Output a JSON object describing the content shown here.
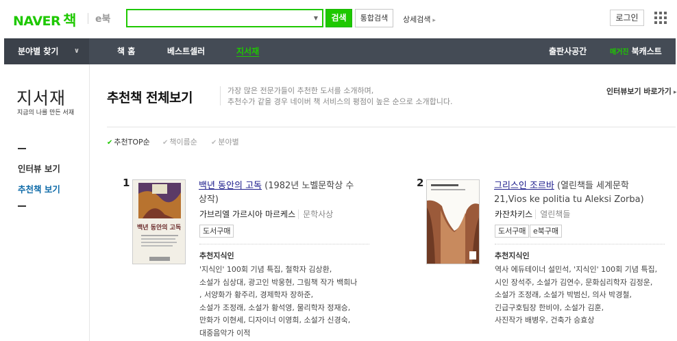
{
  "header": {
    "logo_naver": "NAVER",
    "logo_book": "책",
    "ebook": "e북",
    "search": {
      "value": "",
      "placeholder": ""
    },
    "search_button": "검색",
    "total_search_button": "통합검색",
    "detail_search": "상세검색",
    "login": "로그인",
    "apps_icon": "grid-apps-icon"
  },
  "nav": {
    "category": "분야별 찾기",
    "items": [
      "책 홈",
      "베스트셀러",
      "지서재"
    ],
    "active": "지서재",
    "publisher": "출판사공간",
    "magazine_tag": "매거진",
    "magazine": "북캐스트"
  },
  "sidebar": {
    "title": "지서재",
    "subtitle": "지금의 나를 만든 서재",
    "links": [
      "인터뷰 보기",
      "추천책 보기"
    ]
  },
  "main": {
    "title": "추천책 전체보기",
    "desc_line1": "가장 많은 전문가들이 추천한 도서를 소개하며,",
    "desc_line2": "추천수가 같을 경우 네이버 책 서비스의 평점이 높은 순으로 소개합니다.",
    "interview_link": "인터뷰보기 바로가기",
    "sort_options": [
      "추천TOP순",
      "책이름순",
      "분야별"
    ],
    "sort_active": "추천TOP순"
  },
  "books": [
    {
      "rank": "1",
      "title": "백년 동안의 고독",
      "subtitle_line1": " (1982년 노벨문학상 수",
      "subtitle_line2": "상작)",
      "author": "가브리엘 가르시아 마르케스",
      "publisher": "문학사상",
      "tags": [
        "도서구매"
      ],
      "rec_label": "추천지식인",
      "rec_lines": [
        "'지식인' 100회 기념 특집, 철학자 김상환,",
        "소설가 심상대, 광고인 박웅현, 그림책 작가 백희나",
        ", 서양화가 황주리, 경제학자 장하준,",
        "소설가 조정래, 소설가 황석영, 물리학자 정재승,",
        "만화가 이현세, 디자이너 이영희, 소설가 신경숙,",
        "대중음악가 이적"
      ]
    },
    {
      "rank": "2",
      "title": "그리스인 조르바",
      "subtitle_line1": " (열린책들 세계문학",
      "subtitle_line2": "21,Vios ke politia tu Aleksi Zorba)",
      "author": "카잔차키스",
      "publisher": "열린책들",
      "tags": [
        "도서구매",
        "e북구매"
      ],
      "rec_label": "추천지식인",
      "rec_lines": [
        "역사 에듀테이너 설민석, '지식인' 100회 기념 특집,",
        "시인 장석주, 소설가 김연수, 문화심리학자 김정운,",
        "소설가 조정래, 소설가 박범신, 의사 박경철,",
        "긴급구호팀장 한비야, 소설가 김훈,",
        "사진작가 배병우, 건축가 승효상"
      ]
    }
  ],
  "colors": {
    "brand_green": "#1ec800",
    "nav_bg": "#444b55",
    "link_blue": "#0d6aa8"
  }
}
